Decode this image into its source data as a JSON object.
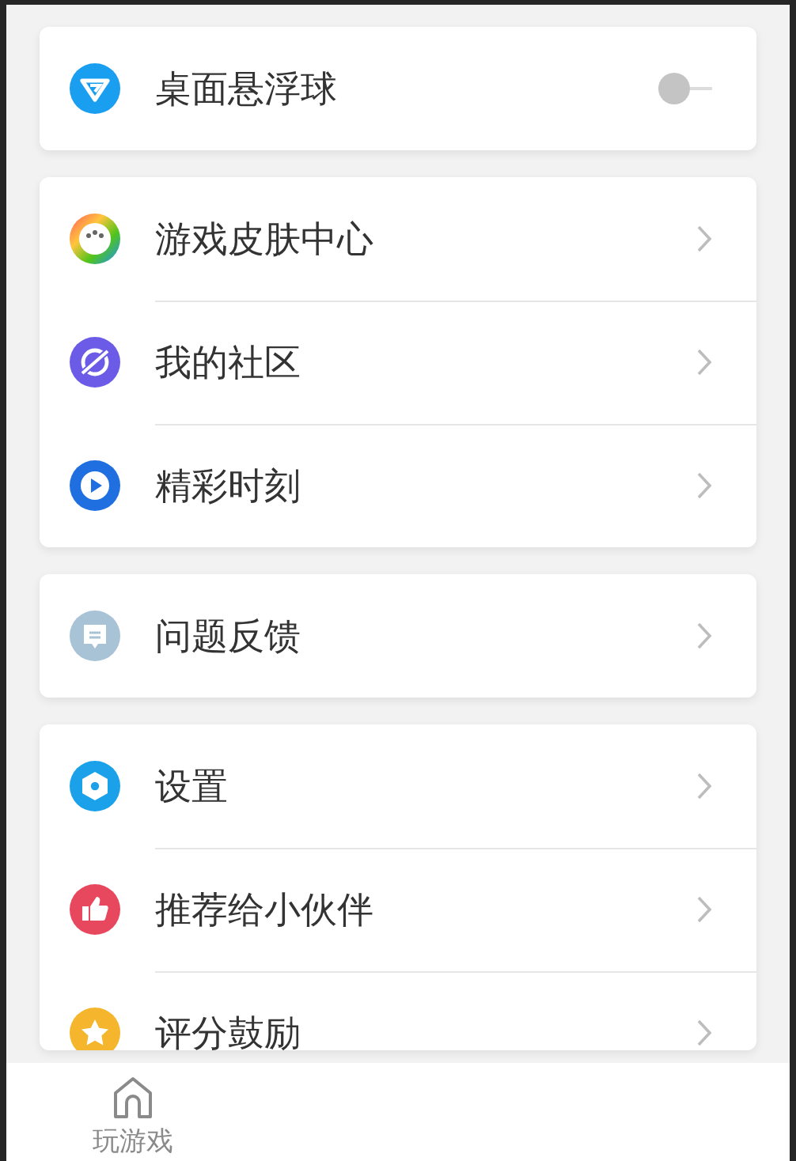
{
  "floating_ball": {
    "label": "桌面悬浮球",
    "on": false
  },
  "groups": [
    {
      "items": [
        {
          "label": "游戏皮肤中心"
        },
        {
          "label": "我的社区"
        },
        {
          "label": "精彩时刻"
        }
      ]
    },
    {
      "items": [
        {
          "label": "问题反馈"
        }
      ]
    },
    {
      "items": [
        {
          "label": "设置"
        },
        {
          "label": "推荐给小伙伴"
        },
        {
          "label": "评分鼓励"
        }
      ]
    }
  ],
  "bottom_nav": [
    {
      "label": "玩游戏",
      "selected": false
    }
  ]
}
